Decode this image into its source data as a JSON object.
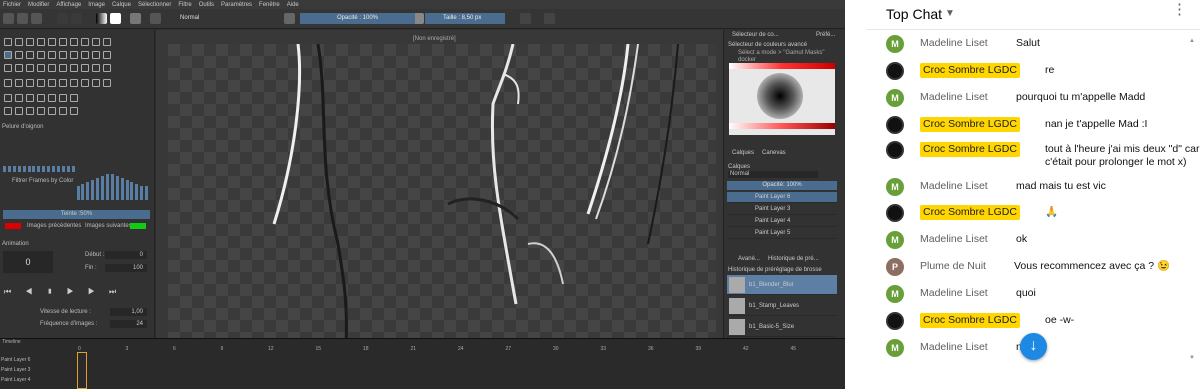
{
  "krita": {
    "menu": [
      "Fichier",
      "Modifier",
      "Affichage",
      "Image",
      "Calque",
      "Sélectionner",
      "Filtre",
      "Outils",
      "Paramètres",
      "Fenêtre",
      "Aide"
    ],
    "toolbar": {
      "blend_mode": "Normal",
      "opacity": "Opacité : 100%",
      "size": "Taille : 8,50 px"
    },
    "document_title": "[Non enregistré]",
    "left_panel": {
      "onion_title": "Pelure d'oignon",
      "filter_by_color": "Filtrer Frames by Color",
      "tint": "Teinte :50%",
      "prev_images": "Images précédentes",
      "next_images": "Images suivantes",
      "animation_title": "Animation",
      "frame": "0",
      "start_label": "Début :",
      "start_value": "0",
      "end_label": "Fin :",
      "end_value": "100",
      "speed_label": "Vitesse de lecture :",
      "speed_value": "1,00",
      "fps_label": "Fréquence d'images :",
      "fps_value": "24"
    },
    "right_panel": {
      "tab1": "Sélecteur de co...",
      "tab2": "Préfé...",
      "color_title": "Sélecteur de couleurs avancé",
      "color_note1": "Sélect a mode > \"Gamut Masks\"",
      "color_note2": "docker",
      "tab_layers": "Calques",
      "tab_canvas": "Canevas",
      "layers_title": "Calques",
      "layer_blend": "Normal",
      "layer_opacity": "Opacité: 100%",
      "layers": [
        "Paint Layer 6",
        "Paint Layer 3",
        "Paint Layer 4",
        "Paint Layer 5"
      ],
      "brush_tab1": "Avané...",
      "brush_tab2": "Historique de pré...",
      "brush_title": "Historique de préréglage de brosse",
      "brushes": [
        "b1_Blender_Blur",
        "b1_Stamp_Leaves",
        "b1_Basic-5_Size"
      ]
    },
    "timeline": {
      "title": "Timeline",
      "ticks": [
        "0",
        "3",
        "6",
        "9",
        "12",
        "15",
        "18",
        "21",
        "24",
        "27",
        "30",
        "33",
        "36",
        "39",
        "42",
        "45"
      ],
      "rows": [
        "Paint Layer 6",
        "Paint Layer 3",
        "Paint Layer 4"
      ]
    }
  },
  "chat": {
    "title": "Top Chat",
    "messages": [
      {
        "author": "Madeline Liset",
        "initial": "M",
        "kind": "member",
        "text": "Salut"
      },
      {
        "author": "Croc Sombre LGDC",
        "initial": "",
        "kind": "mod",
        "text": "re"
      },
      {
        "author": "Madeline Liset",
        "initial": "M",
        "kind": "member",
        "text": "pourquoi tu m'appelle Madd"
      },
      {
        "author": "Croc Sombre LGDC",
        "initial": "",
        "kind": "mod",
        "text": "nan je t'appelle Mad :I"
      },
      {
        "author": "Croc Sombre LGDC",
        "initial": "",
        "kind": "mod",
        "text": "tout à l'heure j'ai mis deux \"d\" car c'était pour prolonger le mot x)"
      },
      {
        "author": "Madeline Liset",
        "initial": "M",
        "kind": "member",
        "text": "mad mais tu est vic"
      },
      {
        "author": "Croc Sombre LGDC",
        "initial": "",
        "kind": "mod",
        "text": "🙏"
      },
      {
        "author": "Madeline Liset",
        "initial": "M",
        "kind": "member",
        "text": "ok"
      },
      {
        "author": "Plume de Nuit",
        "initial": "P",
        "kind": "other",
        "text": "Vous recommencez avec ça ? 😉"
      },
      {
        "author": "Madeline Liset",
        "initial": "M",
        "kind": "member",
        "text": "quoi"
      },
      {
        "author": "Croc Sombre LGDC",
        "initial": "",
        "kind": "mod",
        "text": "oe -w-"
      },
      {
        "author": "Madeline Liset",
        "initial": "M",
        "kind": "member",
        "text": "nuit"
      }
    ]
  },
  "colors": {
    "accent": "#1e88e5",
    "mod_badge": "#ffd600",
    "member_avatar": "#689f38",
    "other_avatar": "#8d6e63",
    "krita_highlight": "#4a6c8f"
  },
  "icons": [
    "chevron-down-icon",
    "more-vert-icon",
    "arrow-down-icon",
    "krita-tool-icons"
  ]
}
